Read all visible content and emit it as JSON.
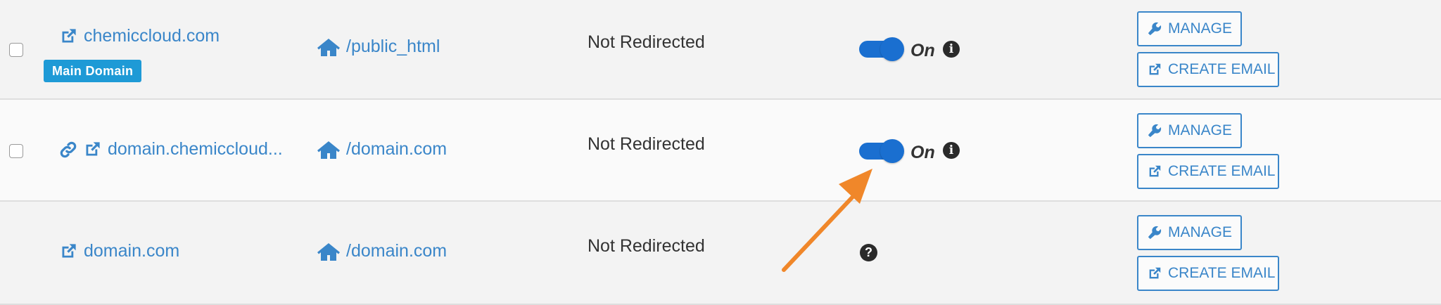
{
  "rows": [
    {
      "domain": "chemiccloud.com",
      "badge": "Main Domain",
      "document_root": "/public_html",
      "redirect_status": "Not Redirected",
      "toggle_state": "on",
      "toggle_label": "On",
      "manage_label": "MANAGE",
      "email_label": "CREATE EMAIL"
    },
    {
      "domain": "domain.chemiccloud...",
      "document_root": "/domain.com",
      "redirect_status": "Not Redirected",
      "toggle_state": "on",
      "toggle_label": "On",
      "manage_label": "MANAGE",
      "email_label": "CREATE EMAIL"
    },
    {
      "domain": "domain.com",
      "document_root": "/domain.com",
      "redirect_status": "Not Redirected",
      "help_icon": "?",
      "manage_label": "MANAGE",
      "email_label": "CREATE EMAIL"
    }
  ],
  "info_icon": "i",
  "colors": {
    "link": "#3a86c9",
    "toggle_on": "#1a6fd0",
    "badge": "#1e9ad6",
    "annotation_arrow": "#f0872a"
  },
  "icons": {
    "external_link": "external-link-icon",
    "chain_link": "link-icon",
    "home": "home-icon",
    "wrench": "wrench-icon",
    "info": "info-icon",
    "help": "question-icon"
  }
}
